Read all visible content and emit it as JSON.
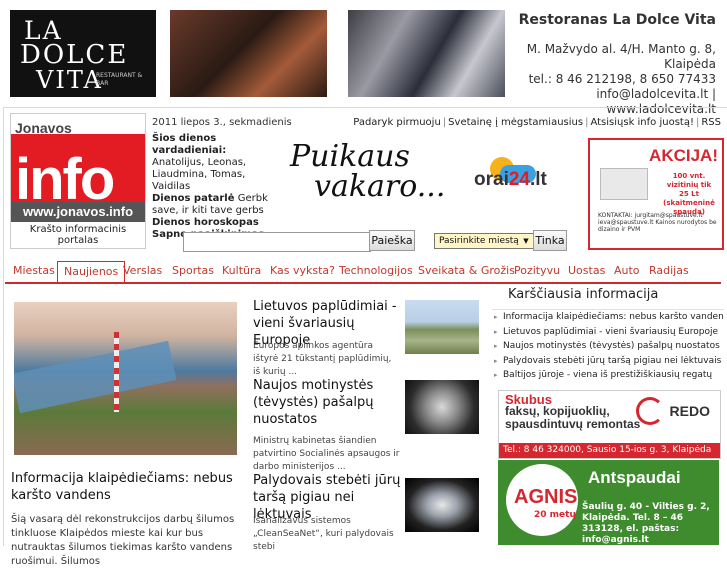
{
  "restaurant": {
    "logo_l1": "LA",
    "logo_l2": "DOLCE",
    "logo_l3": "VITA",
    "logo_sub": "RESTAURANT & BAR",
    "name": "Restoranas La Dolce Vita",
    "address_line1": "M. Mažvydo al. 4/H. Manto g. 8,",
    "address_line2": "Klaipėda",
    "phone": "tel.: 8 46 212198, 8 650 77433",
    "contacts": "info@ladolcevita.lt | www.ladolcevita.lt"
  },
  "portal": {
    "logo_word": "Jonavos",
    "logo_info": "info",
    "logo_url": "www.jonavos.info",
    "logo_tagline": "Krašto informacinis portalas",
    "date": "2011 liepos 3., sekmadienis",
    "top_links": [
      "Padaryk pirmuoju",
      "Svetainę į mėgstamiausius",
      "Atsisiųsk info juostą!",
      "RSS"
    ],
    "names_title": "Šios dienos vardadieniai:",
    "names_line1": "Anatolijus, Leonas,",
    "names_line2": "Liaudmina, Tomas, Vaidilas",
    "proverb_label": "Dienos patarlė",
    "proverb_text": "Gerbk save, ir kiti tave gerbs",
    "horoscope": "Dienos horoskopas",
    "dream": "Sapno paaiškinimas",
    "greeting_l1": "Puikaus",
    "greeting_l2": "vakaro...",
    "orai_text_a": "orai",
    "orai_text_b": "24",
    "orai_text_c": ".lt",
    "search_button": "Paieška",
    "city_select": "Pasirinkite miestą",
    "city_button": "Tinka"
  },
  "akcija_ad": {
    "title": "AKCIJA!",
    "price": "100 vnt. vizitinių tik 25 Lt (skaitmeninė spauda)",
    "contacts": "KONTAKTAI: jurgitam@spaustuve.lt ieva@spaustuve.lt Kainos nurodytos be dizaino ir PVM"
  },
  "nav": {
    "items": [
      "Miestas",
      "Naujienos",
      "Verslas",
      "Sportas",
      "Kultūra",
      "Kas vyksta?",
      "Technologijos",
      "Sveikata & Grožis",
      "Pozityvu",
      "Uostas",
      "Auto",
      "Radijas"
    ]
  },
  "main_article": {
    "headline": "Informacija klaipėdiečiams: nebus karšto vandens",
    "text": "Šią vasarą dėl rekonstrukcijos darbų šilumos tinkluose Klaipėdos mieste kai kur bus nutrauktas šilumos tiekimas karšto vandens ruošimui. Šilumos"
  },
  "mid_articles": [
    {
      "title": "Lietuvos paplūdimiai - vieni švariausių Europoje",
      "text": "Europos aplinkos agentūra ištyrė 21 tūkstantį paplūdimių, iš kurių ..."
    },
    {
      "title": "Naujos motinystės (tėvystės) pašalpų nuostatos",
      "text": "Ministrų kabinetas šiandien patvirtino Socialinės apsaugos ir darbo ministerijos ..."
    },
    {
      "title": "Palydovais stebėti jūrų taršą pigiau nei lėktuvais",
      "text": "Išanalizavus sistemos „CleanSeaNet“, kuri palydovais stebi"
    }
  ],
  "hot_news": {
    "title": "Karščiausia informacija",
    "items": [
      "Informacija klaipėdiečiams: nebus karšto vandens",
      "Lietuvos paplūdimiai - vieni švariausių Europoje",
      "Naujos motinystės (tėvystės) pašalpų nuostatos",
      "Palydovais stebėti jūrų taršą pigiau nei lėktuvais",
      "Baltijos jūroje - viena iš prestižiškiausių regatų"
    ]
  },
  "redo_ad": {
    "line1": "Skubus",
    "line2": "faksų, kopijuoklių, spausdintuvų remontas",
    "logo": "REDO",
    "phone": "Tel.: 8 46 324000, Sausio 15-ios g. 3, Klaipėda"
  },
  "agnis_ad": {
    "logo": "AGNIS",
    "years": "20 metų",
    "title": "Antspaudai",
    "address": "Šaulių g. 40 - Vilties g. 2, Klaipėda. Tel. 8 – 46 313128, el. paštas: info@agnis.lt"
  },
  "colors": {
    "brand_red": "#e31b23",
    "nav_red": "#cd2b2b",
    "agnis_green": "#3e8c2e"
  }
}
